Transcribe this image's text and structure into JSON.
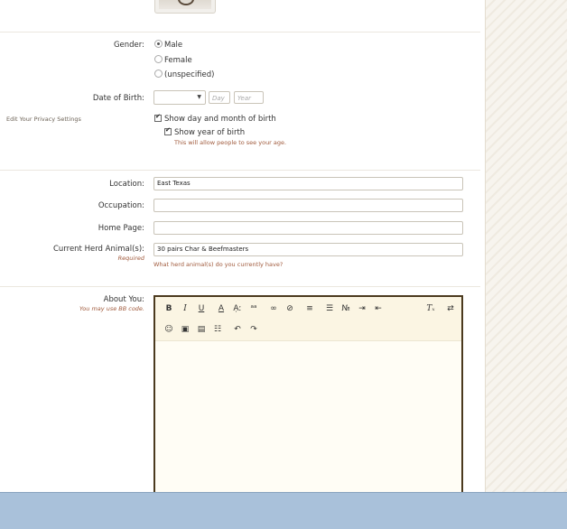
{
  "gender": {
    "label": "Gender:",
    "options": [
      "Male",
      "Female",
      "(unspecified)"
    ],
    "selected": "Male"
  },
  "dob": {
    "label": "Date of Birth:",
    "month_value": "",
    "day_placeholder": "Day",
    "year_placeholder": "Year"
  },
  "privacy": {
    "link": "Edit Your Privacy Settings",
    "show_day_month": "Show day and month of birth",
    "show_year": "Show year of birth",
    "show_year_hint": "This will allow people to see your age."
  },
  "location": {
    "label": "Location:",
    "value": "East Texas"
  },
  "occupation": {
    "label": "Occupation:",
    "value": ""
  },
  "homepage": {
    "label": "Home Page:",
    "value": ""
  },
  "herd": {
    "label": "Current Herd Animal(s):",
    "required": "Required",
    "value": "30 pairs Char & Beefmasters",
    "hint": "What herd animal(s) do you currently have?"
  },
  "about": {
    "label": "About You:",
    "note": "You may use BB code."
  },
  "toolbar_row1": [
    {
      "name": "bold-button",
      "glyph": "B",
      "cls": "b"
    },
    {
      "name": "italic-button",
      "glyph": "I",
      "cls": "i"
    },
    {
      "name": "underline-button",
      "glyph": "U",
      "cls": "u"
    },
    {
      "name": "font-color-button",
      "glyph": "A",
      "cls": "u"
    },
    {
      "name": "font-size-button",
      "glyph": "Ạː",
      "cls": ""
    },
    {
      "name": "font-family-button",
      "glyph": "ᵃᵃ",
      "cls": ""
    },
    {
      "name": "link-button",
      "glyph": "∞",
      "cls": ""
    },
    {
      "name": "unlink-button",
      "glyph": "⊘",
      "cls": ""
    },
    {
      "name": "align-button",
      "glyph": "≡",
      "cls": ""
    },
    {
      "name": "bullet-list-button",
      "glyph": "☰",
      "cls": ""
    },
    {
      "name": "numbered-list-button",
      "glyph": "№",
      "cls": ""
    },
    {
      "name": "indent-button",
      "glyph": "⇥",
      "cls": ""
    },
    {
      "name": "outdent-button",
      "glyph": "⇤",
      "cls": ""
    },
    {
      "name": "remove-format-button",
      "glyph": "Tₓ",
      "cls": "i"
    },
    {
      "name": "toggle-bbcode-button",
      "glyph": "⇄",
      "cls": ""
    }
  ],
  "toolbar_row2": [
    {
      "name": "smilies-button",
      "glyph": "☺"
    },
    {
      "name": "image-button",
      "glyph": "▣"
    },
    {
      "name": "media-button",
      "glyph": "▤"
    },
    {
      "name": "insert-more-button",
      "glyph": "☷"
    },
    {
      "name": "undo-button",
      "glyph": "↶"
    },
    {
      "name": "redo-button",
      "glyph": "↷"
    }
  ]
}
